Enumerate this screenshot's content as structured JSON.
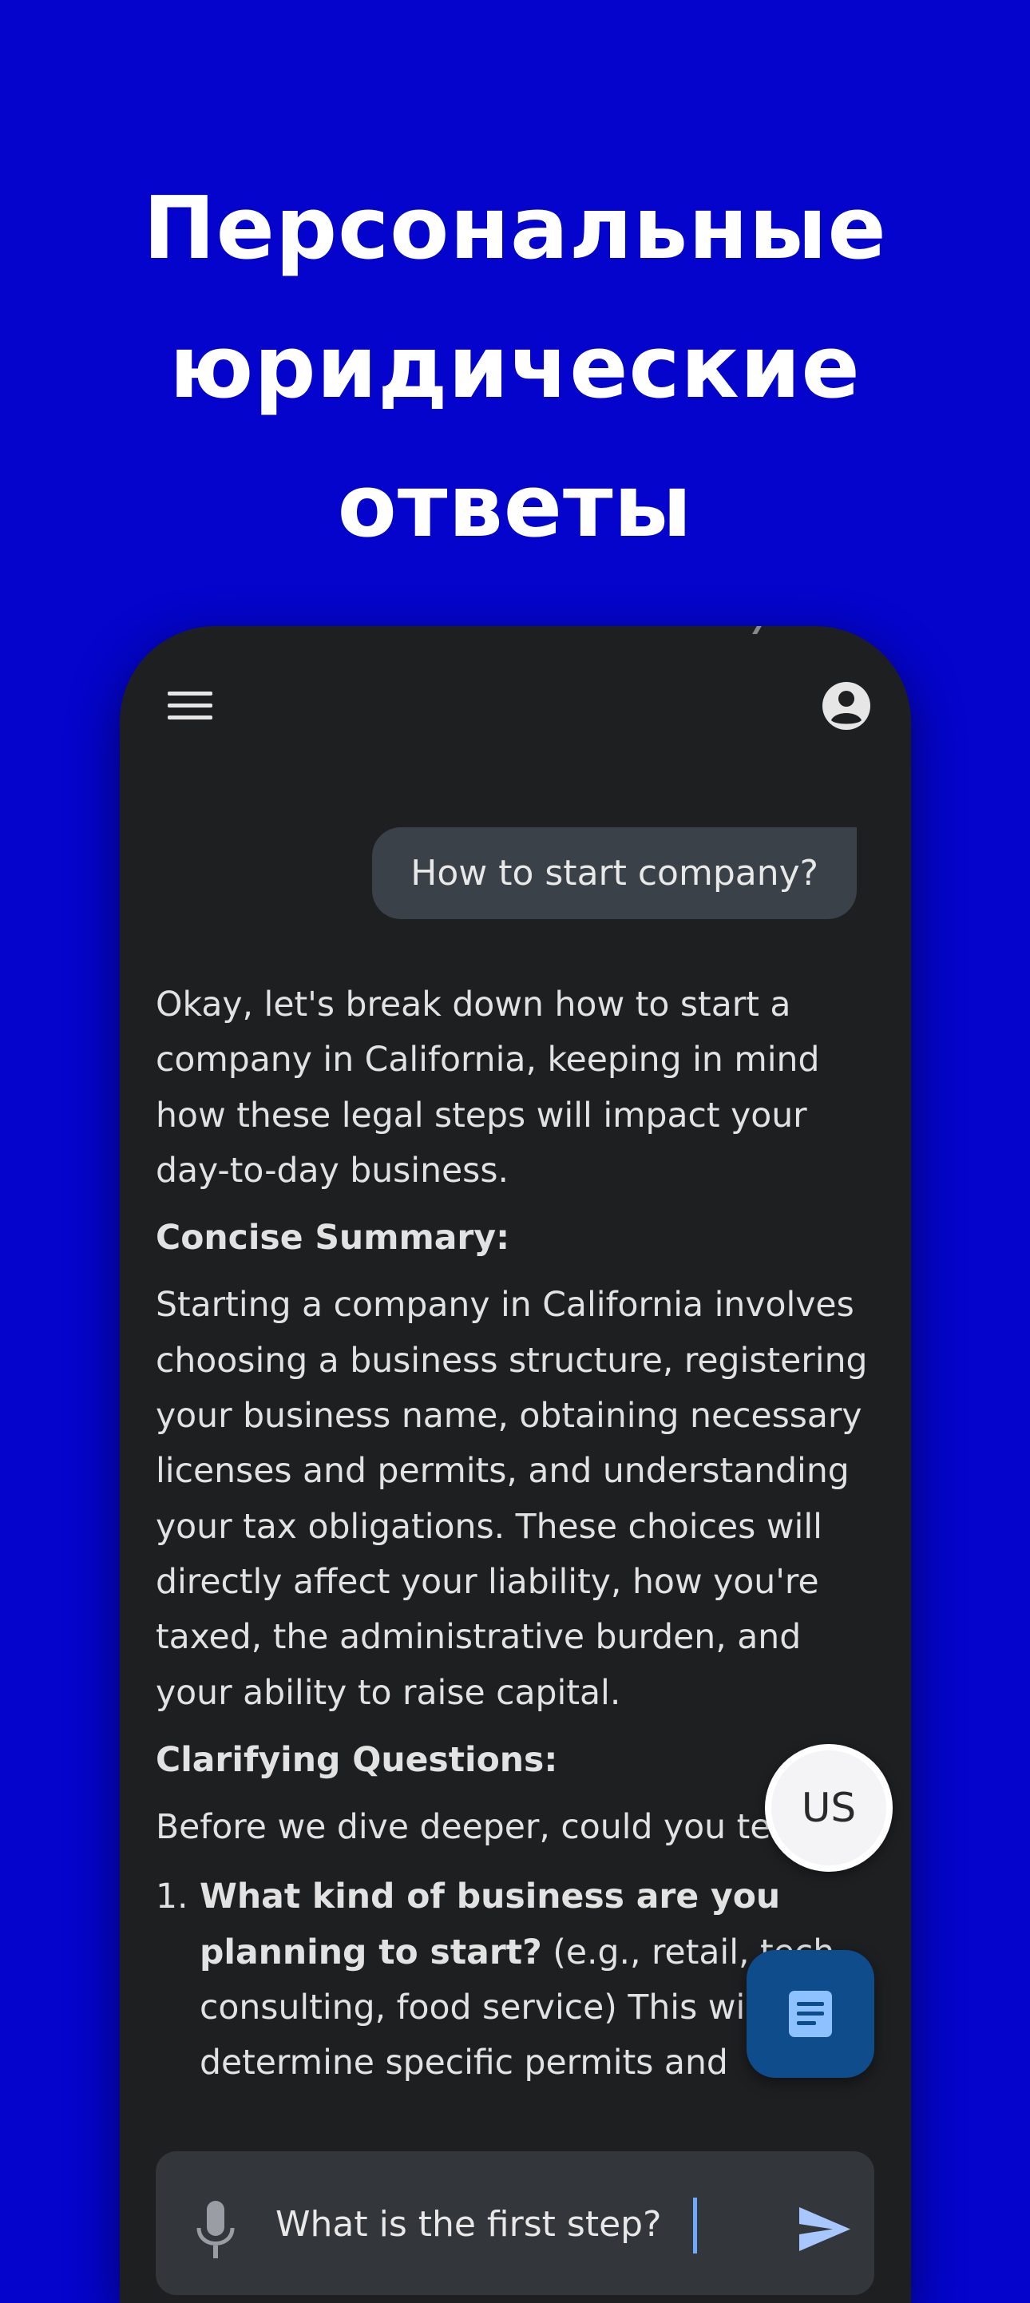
{
  "promo": {
    "title": "Персональные\nюридические\nответы"
  },
  "colors": {
    "background": "#0404CC",
    "phone_surface": "#1E1F21",
    "user_bubble": "#3B4149",
    "fab": "#0F4C8C",
    "send_icon": "#A9C7FF"
  },
  "app_bar": {
    "menu_icon": "hamburger-menu-icon",
    "account_icon": "account-circle-icon"
  },
  "chat": {
    "user_message": "How to start company?",
    "response": {
      "intro": "Okay, let's break down how to start a company in California, keeping in mind how these legal steps will impact your day-to-day business.",
      "summary_heading": "Concise Summary:",
      "summary_text": "Starting a company in California involves choosing a business structure, registering your business name, obtaining necessary licenses and permits, and understanding your tax obligations. These choices will directly affect your liability, how you're taxed, the administrative burden, and your ability to raise capital.",
      "questions_heading": "Clarifying Questions:",
      "questions_intro": "Before we dive deeper, could you tell me:",
      "questions": [
        {
          "number": "1.",
          "bold": "What kind of business are you planning to start?",
          "rest": " (e.g., retail, tech, consulting, food service) This will help determine specific permits and"
        }
      ]
    }
  },
  "floating": {
    "region_label": "US",
    "doc_icon": "document-icon"
  },
  "input": {
    "value": "What is the first step?",
    "mic_icon": "microphone-icon",
    "send_icon": "send-icon"
  }
}
